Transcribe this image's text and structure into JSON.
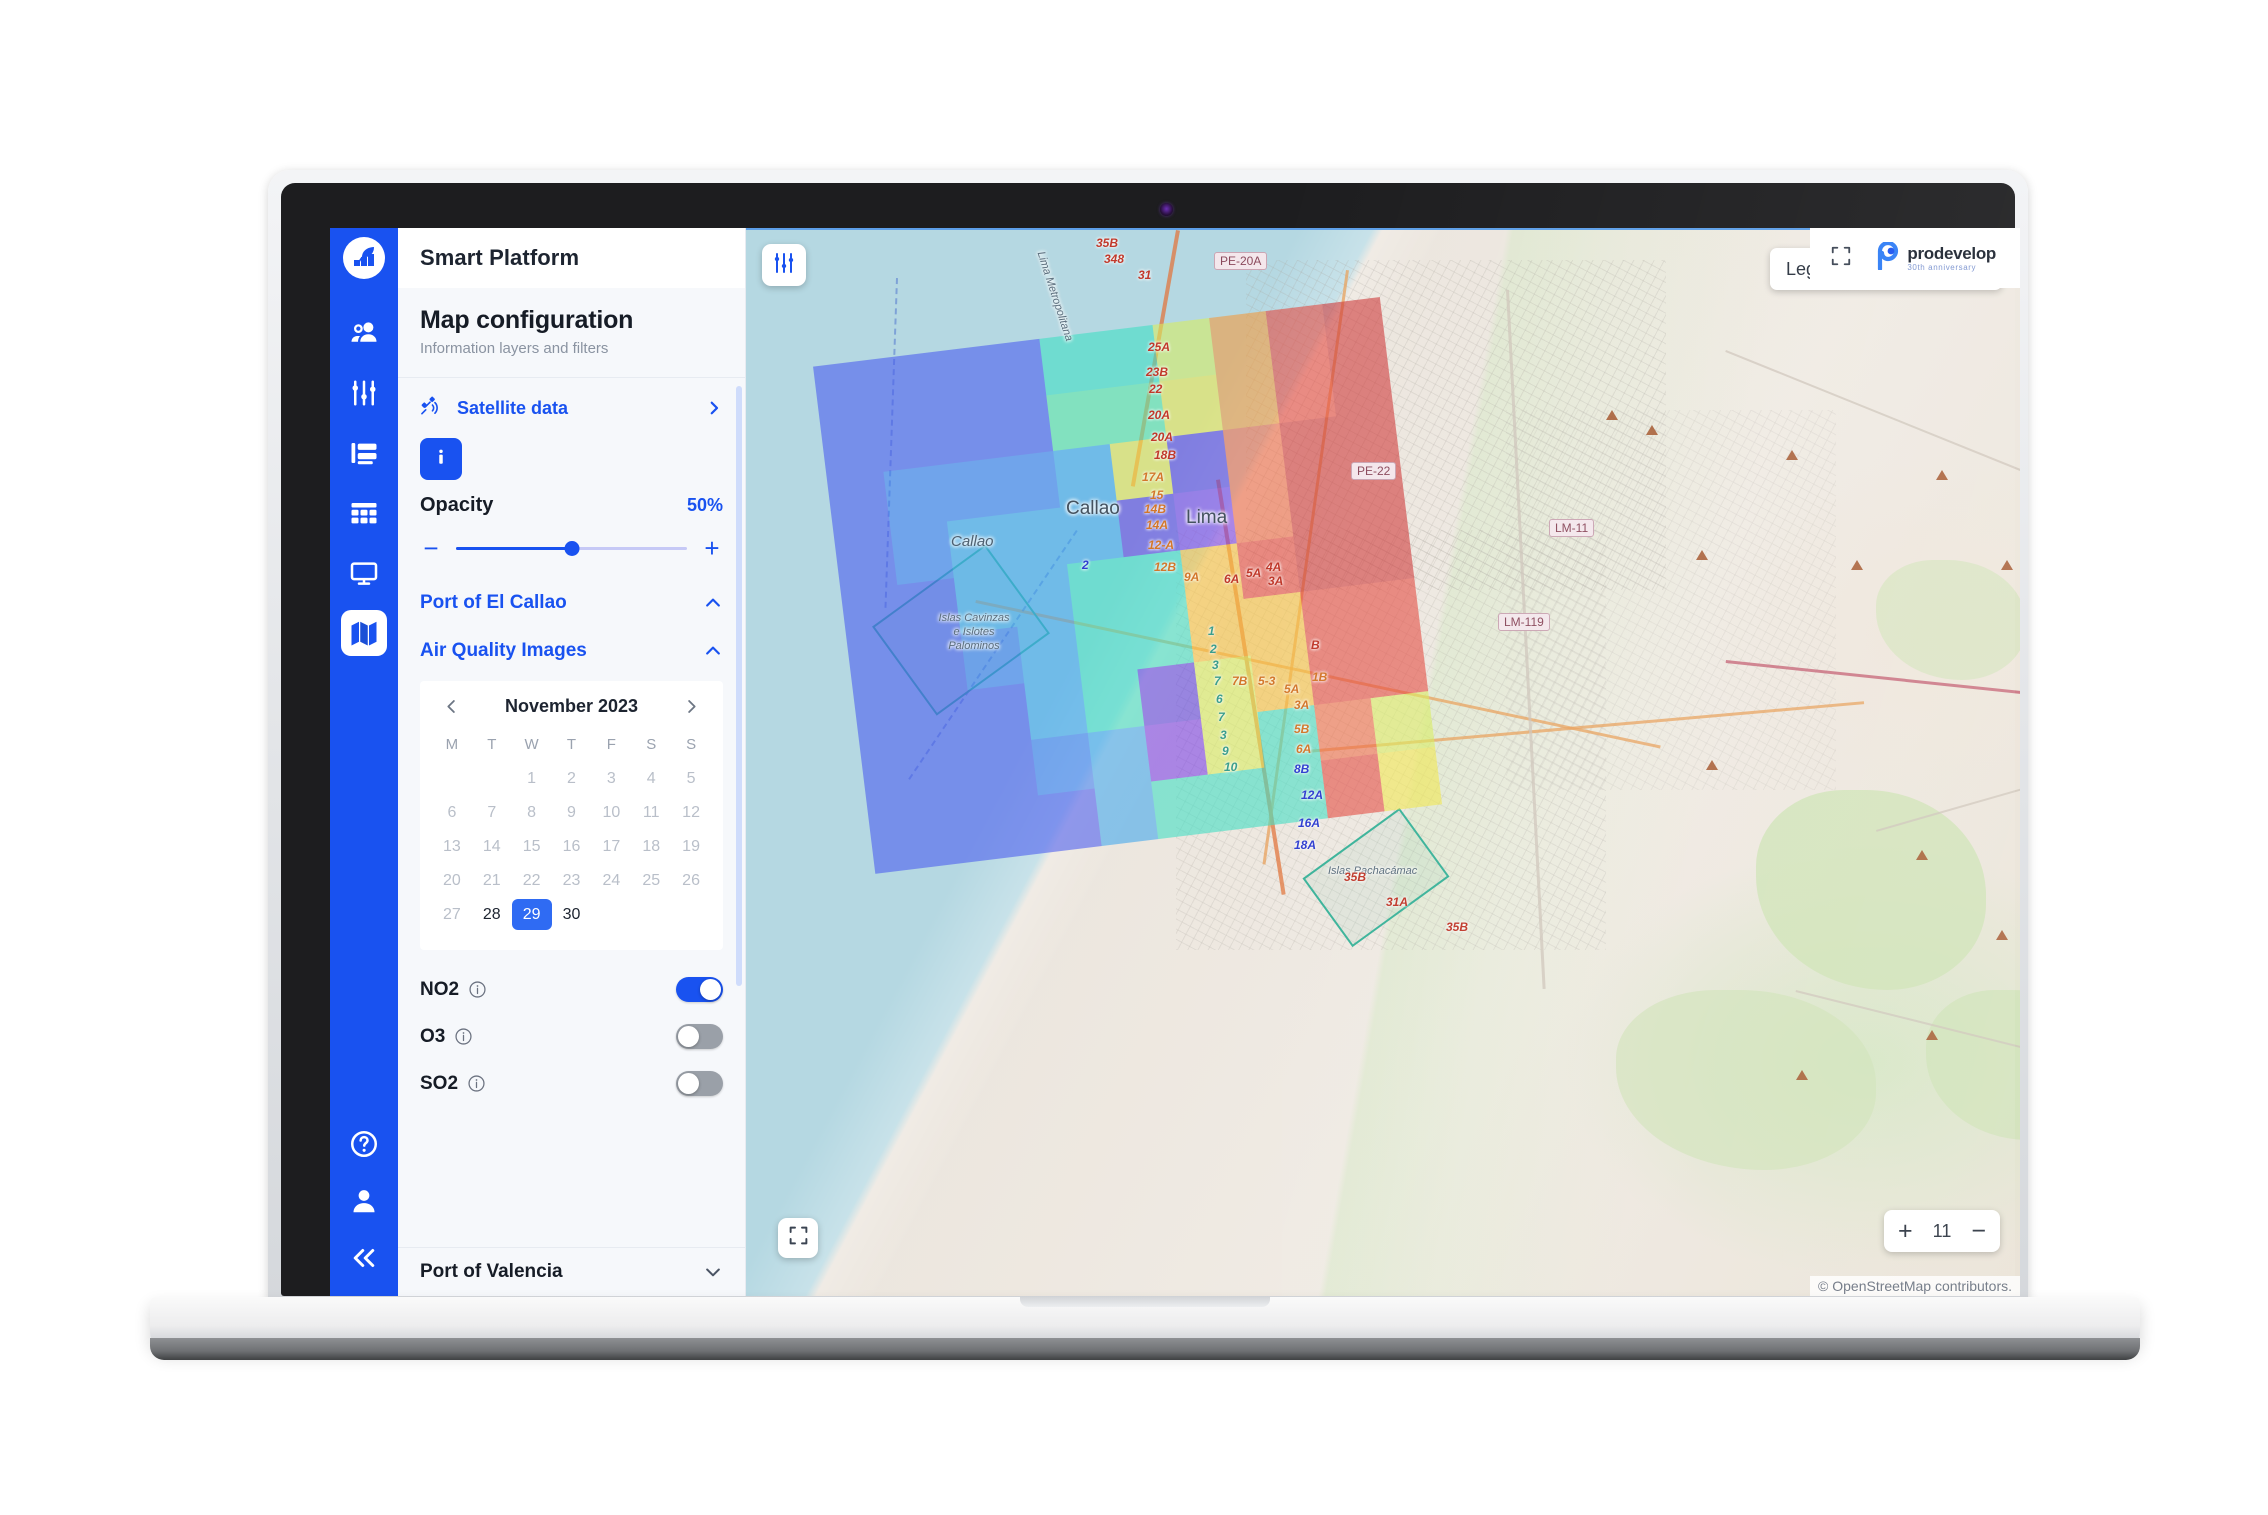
{
  "app": {
    "title": "Smart Platform",
    "brand": {
      "name": "prodevelop",
      "tagline": "30th anniversary"
    },
    "fullscreen_icon": "fullscreen-icon"
  },
  "rail": {
    "logo_icon": "leaf-chart-logo-icon",
    "items": [
      {
        "name": "sidebar-item-users",
        "icon": "users-icon",
        "active": false
      },
      {
        "name": "sidebar-item-filters",
        "icon": "sliders-icon",
        "active": false
      },
      {
        "name": "sidebar-item-lists",
        "icon": "list-icon",
        "active": false
      },
      {
        "name": "sidebar-item-tables",
        "icon": "table-icon",
        "active": false
      },
      {
        "name": "sidebar-item-monitor",
        "icon": "monitor-icon",
        "active": false
      },
      {
        "name": "sidebar-item-map",
        "icon": "map-icon",
        "active": true
      }
    ],
    "bottom": [
      {
        "name": "help-button",
        "icon": "question-circle-icon"
      },
      {
        "name": "account-button",
        "icon": "person-icon"
      },
      {
        "name": "collapse-button",
        "icon": "double-chevron-left-icon"
      }
    ]
  },
  "panel": {
    "heading": "Map configuration",
    "subheading": "Information layers and filters",
    "satellite": {
      "label": "Satellite data",
      "icon": "satellite-icon",
      "chevron": "chevron-right-icon"
    },
    "info_badge": {
      "icon": "info-icon"
    },
    "opacity": {
      "label": "Opacity",
      "value": "50%",
      "percent": 50,
      "minus": "−",
      "plus": "+"
    },
    "sections": [
      {
        "label": "Port of El Callao",
        "state": "expanded",
        "chevron": "chevron-up-icon"
      },
      {
        "label": "Air Quality Images",
        "state": "expanded",
        "chevron": "chevron-up-icon"
      }
    ],
    "footer_section": {
      "label": "Port of Valencia",
      "state": "collapsed",
      "chevron": "chevron-down-icon"
    },
    "calendar": {
      "month_label": "November 2023",
      "prev_icon": "chevron-left-icon",
      "next_icon": "chevron-right-icon",
      "dow": [
        "M",
        "T",
        "W",
        "T",
        "F",
        "S",
        "S"
      ],
      "leading_blanks": 2,
      "days": [
        {
          "n": "1",
          "state": "disabled"
        },
        {
          "n": "2",
          "state": "disabled"
        },
        {
          "n": "3",
          "state": "disabled"
        },
        {
          "n": "4",
          "state": "disabled"
        },
        {
          "n": "5",
          "state": "disabled"
        },
        {
          "n": "6",
          "state": "disabled"
        },
        {
          "n": "7",
          "state": "disabled"
        },
        {
          "n": "8",
          "state": "disabled"
        },
        {
          "n": "9",
          "state": "disabled"
        },
        {
          "n": "10",
          "state": "disabled"
        },
        {
          "n": "11",
          "state": "disabled"
        },
        {
          "n": "12",
          "state": "disabled"
        },
        {
          "n": "13",
          "state": "disabled"
        },
        {
          "n": "14",
          "state": "disabled"
        },
        {
          "n": "15",
          "state": "disabled"
        },
        {
          "n": "16",
          "state": "disabled"
        },
        {
          "n": "17",
          "state": "disabled"
        },
        {
          "n": "18",
          "state": "disabled"
        },
        {
          "n": "19",
          "state": "disabled"
        },
        {
          "n": "20",
          "state": "disabled"
        },
        {
          "n": "21",
          "state": "disabled"
        },
        {
          "n": "22",
          "state": "disabled"
        },
        {
          "n": "23",
          "state": "disabled"
        },
        {
          "n": "24",
          "state": "disabled"
        },
        {
          "n": "25",
          "state": "disabled"
        },
        {
          "n": "26",
          "state": "disabled"
        },
        {
          "n": "27",
          "state": "disabled"
        },
        {
          "n": "28",
          "state": "enabled"
        },
        {
          "n": "29",
          "state": "selected"
        },
        {
          "n": "30",
          "state": "enabled"
        }
      ],
      "selected_day": "29"
    },
    "gases": [
      {
        "label": "NO2",
        "info_icon": "info-circle-icon",
        "on": true
      },
      {
        "label": "O3",
        "info_icon": "info-circle-icon",
        "on": false
      },
      {
        "label": "SO2",
        "info_icon": "info-circle-icon",
        "on": false
      }
    ]
  },
  "map": {
    "filter_button_icon": "sliders-icon",
    "fullscreen_button_icon": "expand-icon",
    "legend": {
      "label": "Legend",
      "expand": "+"
    },
    "zoom": {
      "in": "+",
      "level": "11",
      "out": "−"
    },
    "attribution": "© OpenStreetMap contributors.",
    "labels": [
      {
        "text": "Lima Metropolitana",
        "kind": "tiny"
      },
      {
        "text": "Callao",
        "kind": "place"
      },
      {
        "text": "Callao",
        "kind": "small"
      },
      {
        "text": "Lima",
        "kind": "place"
      },
      {
        "text": "Islas Cavinzas e Islotes Palominos",
        "kind": "tiny"
      },
      {
        "text": "Islas Pachacámac",
        "kind": "tiny"
      }
    ],
    "road_shields": [
      "PE-20A",
      "PE-22",
      "LM-11",
      "LM-119"
    ],
    "road_numbers": [
      "35B",
      "348",
      "31",
      "25A",
      "23B",
      "22",
      "20A",
      "20A",
      "18B",
      "17A",
      "15",
      "14B",
      "14A",
      "12-A",
      "12B",
      "9A",
      "6A",
      "5A",
      "4A",
      "3A",
      "B",
      "1B",
      "5A",
      "3A",
      "5B",
      "6A",
      "8B",
      "12A",
      "16A",
      "18A",
      "35B",
      "31A",
      "35B",
      "2",
      "3",
      "7",
      "7B",
      "5-3",
      "6",
      "7",
      "3",
      "9",
      "10"
    ],
    "colors": {
      "water": "#b5d8e2",
      "land": "#ece6de",
      "accent": "#1952f0"
    }
  }
}
